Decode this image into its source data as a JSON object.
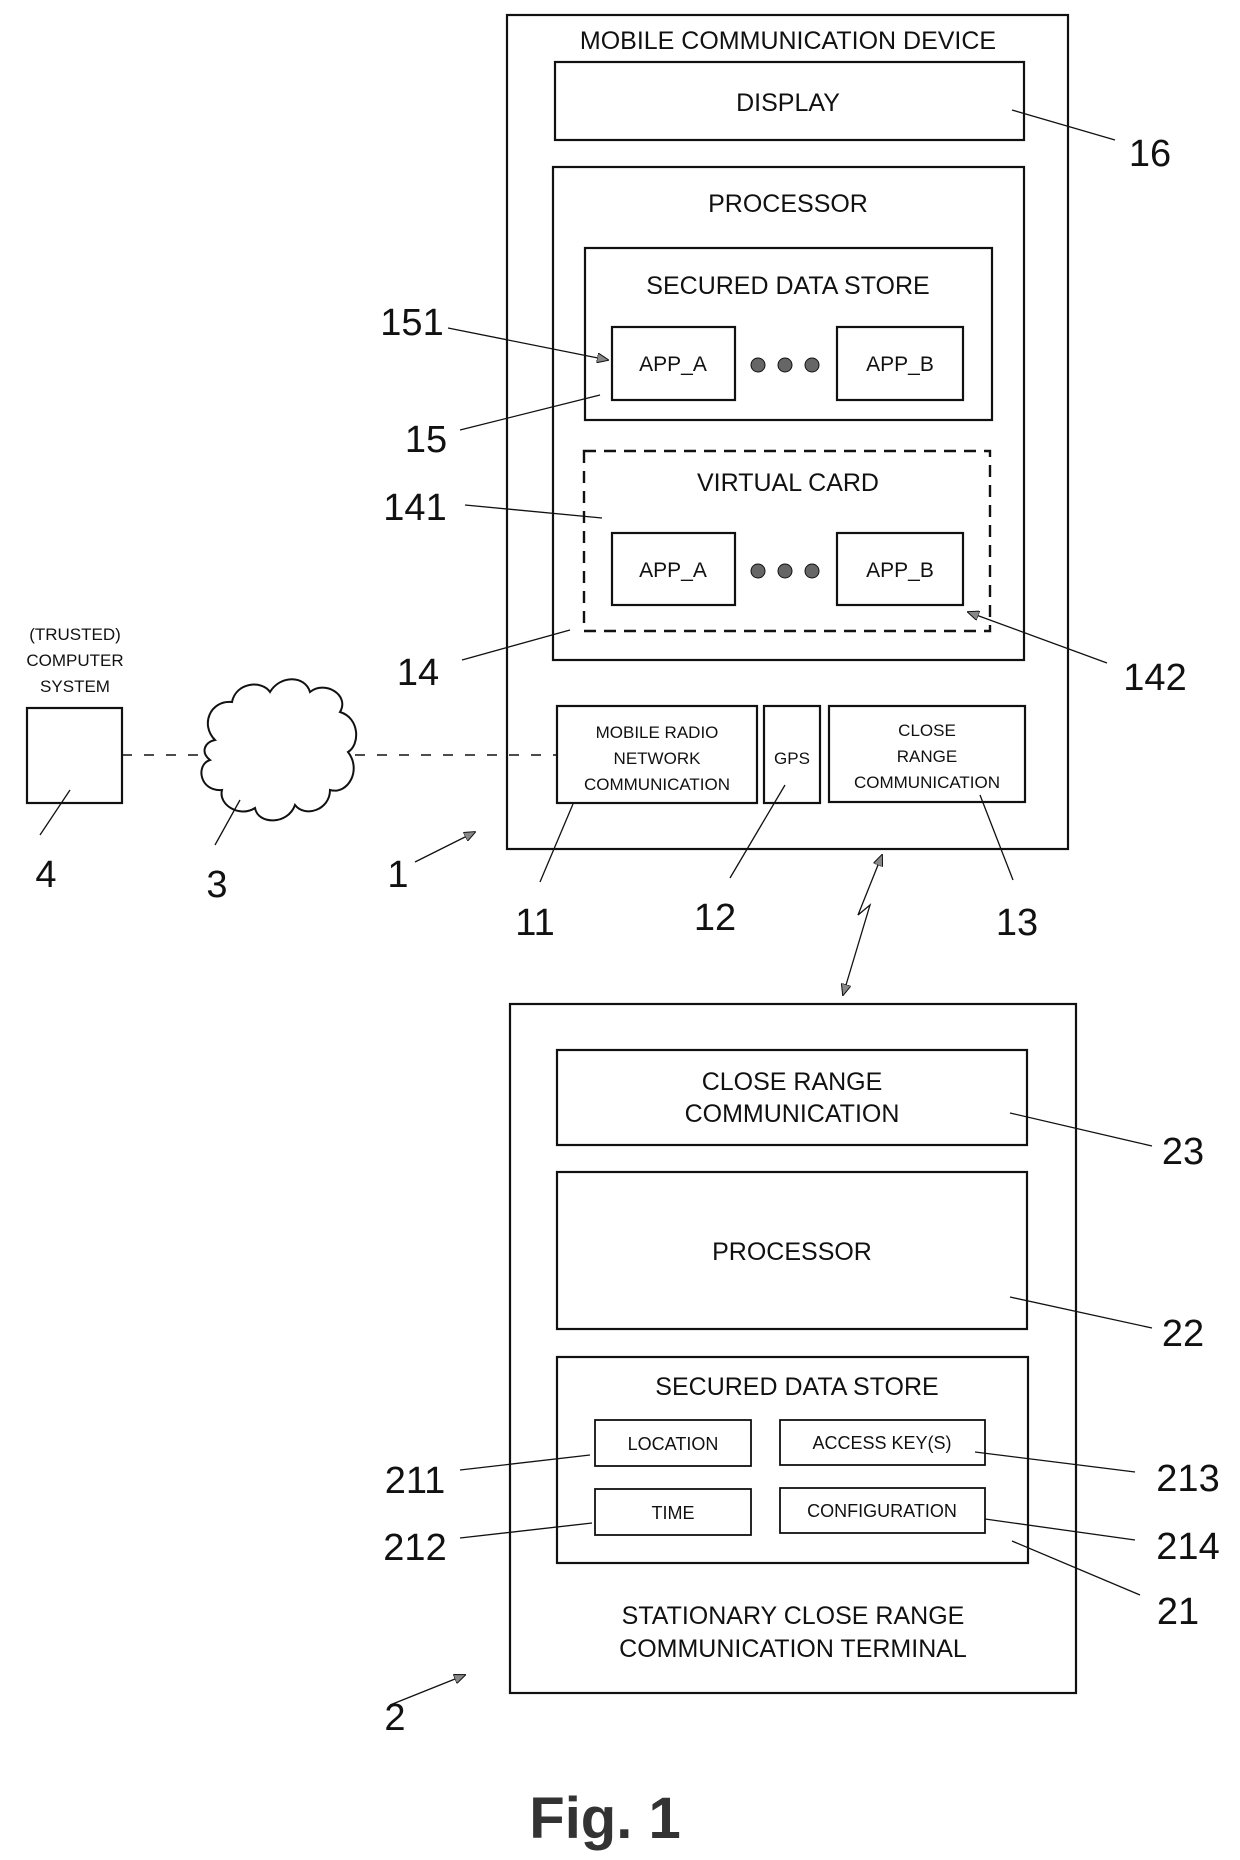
{
  "figure_caption": "Fig. 1",
  "mobile_device": {
    "title": "MOBILE COMMUNICATION DEVICE",
    "display": "DISPLAY",
    "processor": "PROCESSOR",
    "secured_data_store": {
      "title": "SECURED DATA STORE",
      "apps": [
        "APP_A",
        "APP_B"
      ]
    },
    "virtual_card": {
      "title": "VIRTUAL CARD",
      "apps": [
        "APP_A",
        "APP_B"
      ]
    },
    "modules": {
      "mobile_radio": [
        "MOBILE RADIO",
        "NETWORK",
        "COMMUNICATION"
      ],
      "gps": "GPS",
      "close_range": [
        "CLOSE",
        "RANGE",
        "COMMUNICATION"
      ]
    }
  },
  "computer_system": {
    "label_lines": [
      "(TRUSTED)",
      "COMPUTER",
      "SYSTEM"
    ]
  },
  "terminal": {
    "close_range": [
      "CLOSE RANGE",
      "COMMUNICATION"
    ],
    "processor": "PROCESSOR",
    "secured_data_store": {
      "title": "SECURED DATA STORE",
      "items": [
        "LOCATION",
        "ACCESS KEY(S)",
        "TIME",
        "CONFIGURATION"
      ]
    },
    "title_lines": [
      "STATIONARY CLOSE RANGE",
      "COMMUNICATION TERMINAL"
    ]
  },
  "reference_numerals": {
    "r1": "1",
    "r2": "2",
    "r3": "3",
    "r4": "4",
    "r11": "11",
    "r12": "12",
    "r13": "13",
    "r14": "14",
    "r141": "141",
    "r142": "142",
    "r15": "15",
    "r151": "151",
    "r16": "16",
    "r21": "21",
    "r22": "22",
    "r23": "23",
    "r211": "211",
    "r212": "212",
    "r213": "213",
    "r214": "214"
  }
}
